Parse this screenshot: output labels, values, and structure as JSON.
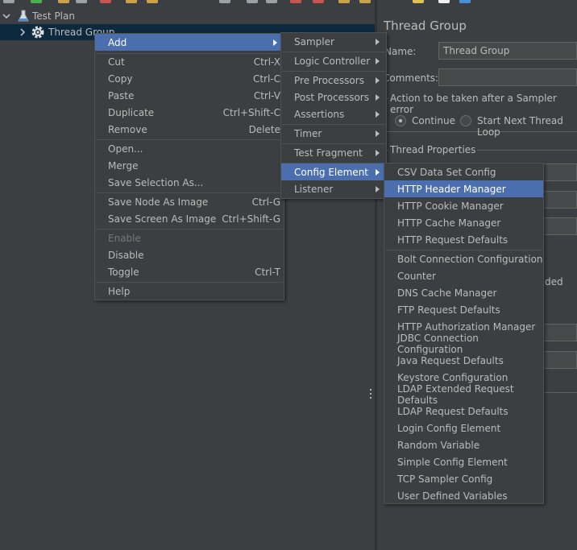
{
  "tree": {
    "items": [
      {
        "label": "Test Plan",
        "icon": "flask-icon"
      },
      {
        "label": "Thread Group",
        "icon": "gear-icon"
      }
    ]
  },
  "panel": {
    "title": "Thread Group",
    "name_label": "Name:",
    "name_value": "Thread Group",
    "comments_label": "Comments:",
    "action_label": "Action to be taken after a Sampler error",
    "radio_continue": "Continue",
    "radio_start_next": "Start Next Thread Loop",
    "thread_props_label": "Thread Properties",
    "partial_text": "ded"
  },
  "context_menu": {
    "add": "Add",
    "cut": {
      "label": "Cut",
      "shortcut": "Ctrl-X"
    },
    "copy": {
      "label": "Copy",
      "shortcut": "Ctrl-C"
    },
    "paste": {
      "label": "Paste",
      "shortcut": "Ctrl-V"
    },
    "duplicate": {
      "label": "Duplicate",
      "shortcut": "Ctrl+Shift-C"
    },
    "remove": {
      "label": "Remove",
      "shortcut": "Delete"
    },
    "open": "Open...",
    "merge": "Merge",
    "save_selection": "Save Selection As...",
    "save_node_image": {
      "label": "Save Node As Image",
      "shortcut": "Ctrl-G"
    },
    "save_screen_image": {
      "label": "Save Screen As Image",
      "shortcut": "Ctrl+Shift-G"
    },
    "enable": "Enable",
    "disable": "Disable",
    "toggle": {
      "label": "Toggle",
      "shortcut": "Ctrl-T"
    },
    "help": "Help"
  },
  "add_submenu": {
    "sampler": "Sampler",
    "logic_controller": "Logic Controller",
    "pre_processors": "Pre Processors",
    "post_processors": "Post Processors",
    "assertions": "Assertions",
    "timer": "Timer",
    "test_fragment": "Test Fragment",
    "config_element": "Config Element",
    "listener": "Listener"
  },
  "config_submenu": {
    "items_top": [
      "CSV Data Set Config",
      "HTTP Header Manager",
      "HTTP Cookie Manager",
      "HTTP Cache Manager",
      "HTTP Request Defaults"
    ],
    "items_bottom": [
      "Bolt Connection Configuration",
      "Counter",
      "DNS Cache Manager",
      "FTP Request Defaults",
      "HTTP Authorization Manager",
      "JDBC Connection Configuration",
      "Java Request Defaults",
      "Keystore Configuration",
      "LDAP Extended Request Defaults",
      "LDAP Request Defaults",
      "Login Config Element",
      "Random Variable",
      "Simple Config Element",
      "TCP Sampler Config",
      "User Defined Variables"
    ],
    "highlighted": "HTTP Header Manager"
  },
  "colors": {
    "background": "#3c3f41",
    "highlight": "#4b6eaf",
    "tree_selection": "#0d293e"
  }
}
